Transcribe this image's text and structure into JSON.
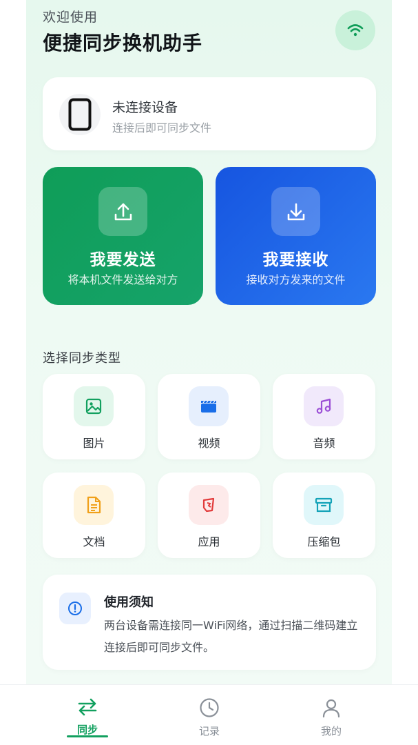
{
  "header": {
    "welcome": "欢迎使用",
    "title": "便捷同步换机助手"
  },
  "device": {
    "status": "未连接设备",
    "hint": "连接后即可同步文件"
  },
  "actions": {
    "send": {
      "title": "我要发送",
      "subtitle": "将本机文件发送给对方"
    },
    "receive": {
      "title": "我要接收",
      "subtitle": "接收对方发来的文件"
    }
  },
  "sync_types": {
    "title": "选择同步类型",
    "items": [
      {
        "label": "图片",
        "icon": "image-icon",
        "color": "#12a05f",
        "bg": "#e3f7ec"
      },
      {
        "label": "视频",
        "icon": "video-icon",
        "color": "#1a6ee8",
        "bg": "#e6effd"
      },
      {
        "label": "音频",
        "icon": "music-icon",
        "color": "#9b4fd6",
        "bg": "#f1e9fb"
      },
      {
        "label": "文档",
        "icon": "document-icon",
        "color": "#f0a01a",
        "bg": "#fff4dc"
      },
      {
        "label": "应用",
        "icon": "app-icon",
        "color": "#e23b3b",
        "bg": "#fdeaea"
      },
      {
        "label": "压缩包",
        "icon": "archive-icon",
        "color": "#14a3b8",
        "bg": "#e0f7fa"
      }
    ]
  },
  "notice": {
    "title": "使用须知",
    "text": "两台设备需连接同一WiFi网络，通过扫描二维码建立连接后即可同步文件。"
  },
  "tabs": [
    {
      "label": "同步",
      "icon": "swap-arrows-icon",
      "active": true
    },
    {
      "label": "记录",
      "icon": "clock-icon",
      "active": false
    },
    {
      "label": "我的",
      "icon": "user-icon",
      "active": false
    }
  ],
  "colors": {
    "accent": "#12a05f",
    "send": "#0f9d58",
    "receive": "#1a5fe6"
  }
}
